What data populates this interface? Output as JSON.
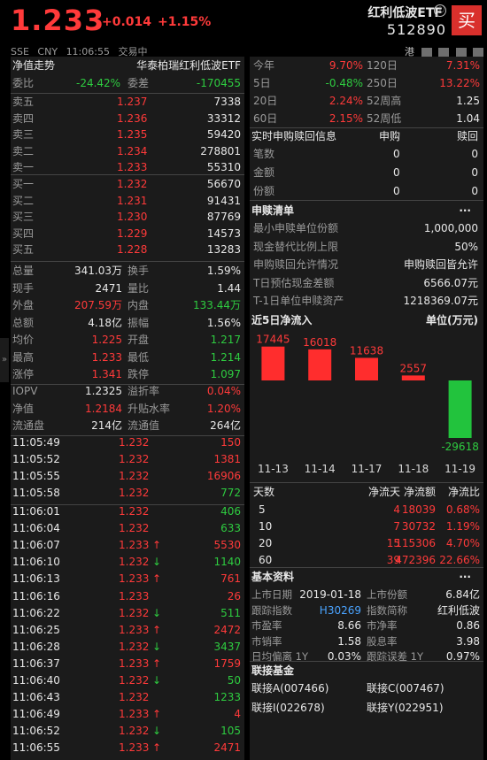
{
  "header": {
    "price": "1.233",
    "change": "+0.014",
    "change_pct": "+1.15%",
    "exchange": "SSE",
    "currency": "CNY",
    "time": "11:06:55",
    "status": "交易中",
    "fund_name": "红利低波ETF",
    "fund_code": "512890",
    "buy_label": "买",
    "tool_label": "港",
    "info_icon": "ⓘ"
  },
  "left": {
    "nav_label": "净值走势",
    "fund_full_name": "华泰柏瑞红利低波ETF",
    "weibi_label": "委比",
    "weibi_value": "-24.42%",
    "weicha_label": "委差",
    "weicha_value": "-170455",
    "asks": [
      {
        "label": "卖五",
        "price": "1.237",
        "vol": "7338"
      },
      {
        "label": "卖四",
        "price": "1.236",
        "vol": "33312"
      },
      {
        "label": "卖三",
        "price": "1.235",
        "vol": "59420"
      },
      {
        "label": "卖二",
        "price": "1.234",
        "vol": "278801"
      },
      {
        "label": "卖一",
        "price": "1.233",
        "vol": "55310"
      }
    ],
    "bids": [
      {
        "label": "买一",
        "price": "1.232",
        "vol": "56670"
      },
      {
        "label": "买二",
        "price": "1.231",
        "vol": "91431"
      },
      {
        "label": "买三",
        "price": "1.230",
        "vol": "87769"
      },
      {
        "label": "买四",
        "price": "1.229",
        "vol": "14573"
      },
      {
        "label": "买五",
        "price": "1.228",
        "vol": "13283"
      }
    ],
    "stats": [
      {
        "l1": "总量",
        "v1": "341.03万",
        "c1": "white",
        "l2": "换手",
        "v2": "1.59%",
        "c2": "white"
      },
      {
        "l1": "现手",
        "v1": "2471",
        "c1": "white",
        "l2": "量比",
        "v2": "1.44",
        "c2": "white"
      },
      {
        "l1": "外盘",
        "v1": "207.59万",
        "c1": "red",
        "l2": "内盘",
        "v2": "133.44万",
        "c2": "green"
      },
      {
        "l1": "总额",
        "v1": "4.18亿",
        "c1": "white",
        "l2": "振幅",
        "v2": "1.56%",
        "c2": "white"
      },
      {
        "l1": "均价",
        "v1": "1.225",
        "c1": "red",
        "l2": "开盘",
        "v2": "1.217",
        "c2": "green"
      },
      {
        "l1": "最高",
        "v1": "1.233",
        "c1": "red",
        "l2": "最低",
        "v2": "1.214",
        "c2": "green"
      },
      {
        "l1": "涨停",
        "v1": "1.341",
        "c1": "red",
        "l2": "跌停",
        "v2": "1.097",
        "c2": "green"
      }
    ],
    "stats2": [
      {
        "l1": "IOPV",
        "v1": "1.2325",
        "c1": "white",
        "l2": "溢折率",
        "v2": "0.04%",
        "c2": "red"
      },
      {
        "l1": "净值",
        "v1": "1.2184",
        "c1": "red",
        "l2": "升贴水率",
        "v2": "1.20%",
        "c2": "red"
      },
      {
        "l1": "流通盘",
        "v1": "214亿",
        "c1": "white",
        "l2": "流通值",
        "v2": "264亿",
        "c2": "white"
      }
    ],
    "ticks_a": [
      {
        "t": "11:05:49",
        "p": "1.232",
        "arrow": "",
        "v": "150",
        "vc": "red"
      },
      {
        "t": "11:05:52",
        "p": "1.232",
        "arrow": "",
        "v": "1381",
        "vc": "red"
      },
      {
        "t": "11:05:55",
        "p": "1.232",
        "arrow": "",
        "v": "16906",
        "vc": "red"
      },
      {
        "t": "11:05:58",
        "p": "1.232",
        "arrow": "",
        "v": "772",
        "vc": "green"
      }
    ],
    "ticks_b": [
      {
        "t": "11:06:01",
        "p": "1.232",
        "arrow": "",
        "v": "406",
        "vc": "green"
      },
      {
        "t": "11:06:04",
        "p": "1.232",
        "arrow": "",
        "v": "633",
        "vc": "green"
      },
      {
        "t": "11:06:07",
        "p": "1.233",
        "arrow": "↑",
        "v": "5530",
        "vc": "red"
      },
      {
        "t": "11:06:10",
        "p": "1.232",
        "arrow": "↓",
        "v": "1140",
        "vc": "green"
      },
      {
        "t": "11:06:13",
        "p": "1.233",
        "arrow": "↑",
        "v": "761",
        "vc": "red"
      },
      {
        "t": "11:06:16",
        "p": "1.233",
        "arrow": "",
        "v": "26",
        "vc": "red"
      },
      {
        "t": "11:06:22",
        "p": "1.232",
        "arrow": "↓",
        "v": "511",
        "vc": "green"
      },
      {
        "t": "11:06:25",
        "p": "1.233",
        "arrow": "↑",
        "v": "2472",
        "vc": "red"
      },
      {
        "t": "11:06:28",
        "p": "1.232",
        "arrow": "↓",
        "v": "3437",
        "vc": "green"
      },
      {
        "t": "11:06:37",
        "p": "1.233",
        "arrow": "↑",
        "v": "1759",
        "vc": "red"
      },
      {
        "t": "11:06:40",
        "p": "1.232",
        "arrow": "↓",
        "v": "50",
        "vc": "green"
      },
      {
        "t": "11:06:43",
        "p": "1.232",
        "arrow": "",
        "v": "1233",
        "vc": "green"
      },
      {
        "t": "11:06:49",
        "p": "1.233",
        "arrow": "↑",
        "v": "4",
        "vc": "red"
      },
      {
        "t": "11:06:52",
        "p": "1.232",
        "arrow": "↓",
        "v": "105",
        "vc": "green"
      },
      {
        "t": "11:06:55",
        "p": "1.233",
        "arrow": "↑",
        "v": "2471",
        "vc": "red"
      }
    ]
  },
  "right": {
    "returns": [
      {
        "l1": "今年",
        "v1": "9.70%",
        "c1": "red",
        "l2": "120日",
        "v2": "7.31%",
        "c2": "red"
      },
      {
        "l1": "5日",
        "v1": "-0.48%",
        "c1": "green",
        "l2": "250日",
        "v2": "13.22%",
        "c2": "red"
      },
      {
        "l1": "20日",
        "v1": "2.24%",
        "c1": "red",
        "l2": "52周高",
        "v2": "1.25",
        "c2": "white"
      },
      {
        "l1": "60日",
        "v1": "2.15%",
        "c1": "red",
        "l2": "52周低",
        "v2": "1.04",
        "c2": "white"
      }
    ],
    "sr": {
      "title": "实时申购赎回信息",
      "col1": "申购",
      "col2": "赎回",
      "rows": [
        {
          "label": "笔数",
          "a": "0",
          "b": "0"
        },
        {
          "label": "金额",
          "a": "0",
          "b": "0"
        },
        {
          "label": "份额",
          "a": "0",
          "b": "0"
        }
      ]
    },
    "list": {
      "title": "申赎清单",
      "more": "···",
      "rows": [
        {
          "label": "最小申赎单位份额",
          "value": "1,000,000"
        },
        {
          "label": "现金替代比例上限",
          "value": "50%"
        },
        {
          "label": "申购赎回允许情况",
          "value": "申购赎回皆允许"
        },
        {
          "label": "T日预估现金差额",
          "value": "6566.07元"
        },
        {
          "label": "T-1日单位申赎资产",
          "value": "1218369.07元"
        }
      ]
    },
    "flow": {
      "title": "近5日净流入",
      "unit": "单位(万元)"
    },
    "flow_table": {
      "headers": [
        "天数",
        "净流天",
        "净流额",
        "净流比"
      ],
      "rows": [
        {
          "d": "5",
          "n": "4",
          "amt": "18039",
          "pct": "0.68%"
        },
        {
          "d": "10",
          "n": "7",
          "amt": "30732",
          "pct": "1.19%"
        },
        {
          "d": "20",
          "n": "15",
          "amt": "115306",
          "pct": "4.70%"
        },
        {
          "d": "60",
          "n": "39",
          "amt": "472396",
          "pct": "22.66%"
        }
      ]
    },
    "basic": {
      "title": "基本资料",
      "more": "···",
      "rows": [
        {
          "l1": "上市日期",
          "v1": "2019-01-18",
          "c1": "white",
          "l2": "上市份额",
          "v2": "6.84亿",
          "c2": "white"
        },
        {
          "l1": "跟踪指数",
          "v1": "H30269",
          "c1": "blue",
          "l2": "指数简称",
          "v2": "红利低波",
          "c2": "white"
        },
        {
          "l1": "市盈率",
          "v1": "8.66",
          "c1": "white",
          "l2": "市净率",
          "v2": "0.86",
          "c2": "white"
        },
        {
          "l1": "市销率",
          "v1": "1.58",
          "c1": "white",
          "l2": "股息率",
          "v2": "3.98",
          "c2": "white"
        },
        {
          "l1": "日均偏离 1Y",
          "v1": "0.03%",
          "c1": "white",
          "l2": "跟踪误差 1Y",
          "v2": "0.97%",
          "c2": "white"
        }
      ]
    },
    "links": {
      "title": "联接基金",
      "items": [
        "联接A(007466)",
        "联接C(007467)",
        "联接I(022678)",
        "联接Y(022951)"
      ]
    }
  },
  "chart_data": {
    "type": "bar",
    "title": "近5日净流入",
    "ylabel": "单位(万元)",
    "categories": [
      "11-13",
      "11-14",
      "11-17",
      "11-18",
      "11-19"
    ],
    "values": [
      17445,
      16018,
      11638,
      2557,
      -29618
    ],
    "value_labels": [
      "17445",
      "16018",
      "11638",
      "2557",
      "-29618"
    ],
    "colors": {
      "positive": "#ff2d2d",
      "negative": "#22c33d"
    }
  }
}
